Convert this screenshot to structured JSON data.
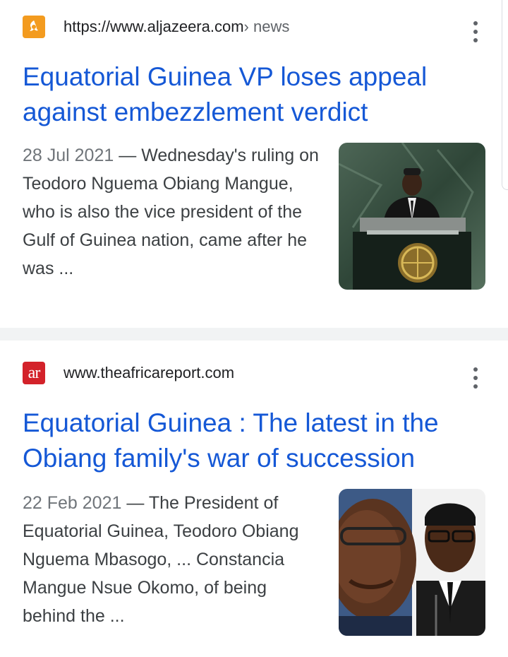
{
  "results": [
    {
      "favicon_text": "",
      "url": "https://www.aljazeera.com",
      "breadcrumb": " › news",
      "title": "Equatorial Guinea VP loses appeal against embezzlement verdict",
      "date": "28 Jul 2021",
      "separator": " — ",
      "snippet": "Wednesday's ruling on Teodoro Nguema Obiang Mangue, who is also the vice president of the Gulf of Guinea nation, came after he was ...",
      "thumbnail_icon": "podium-speaker-image"
    },
    {
      "favicon_text": "ar",
      "url": "www.theafricareport.com",
      "breadcrumb": "",
      "title": "Equatorial Guinea : The latest in the Obiang family's war of succession",
      "date": "22 Feb 2021",
      "separator": " — ",
      "snippet": "The President of Equatorial Guinea, Teodoro Obiang Nguema Mbasogo, ... Constancia Mangue Nsue Okomo, of being behind the ...",
      "thumbnail_icon": "two-portraits-image"
    }
  ],
  "colors": {
    "title_link": "#1558d6",
    "aljazeera_brand": "#f39b1f",
    "africareport_brand": "#d3222a",
    "page_background": "#f1f3f4"
  }
}
